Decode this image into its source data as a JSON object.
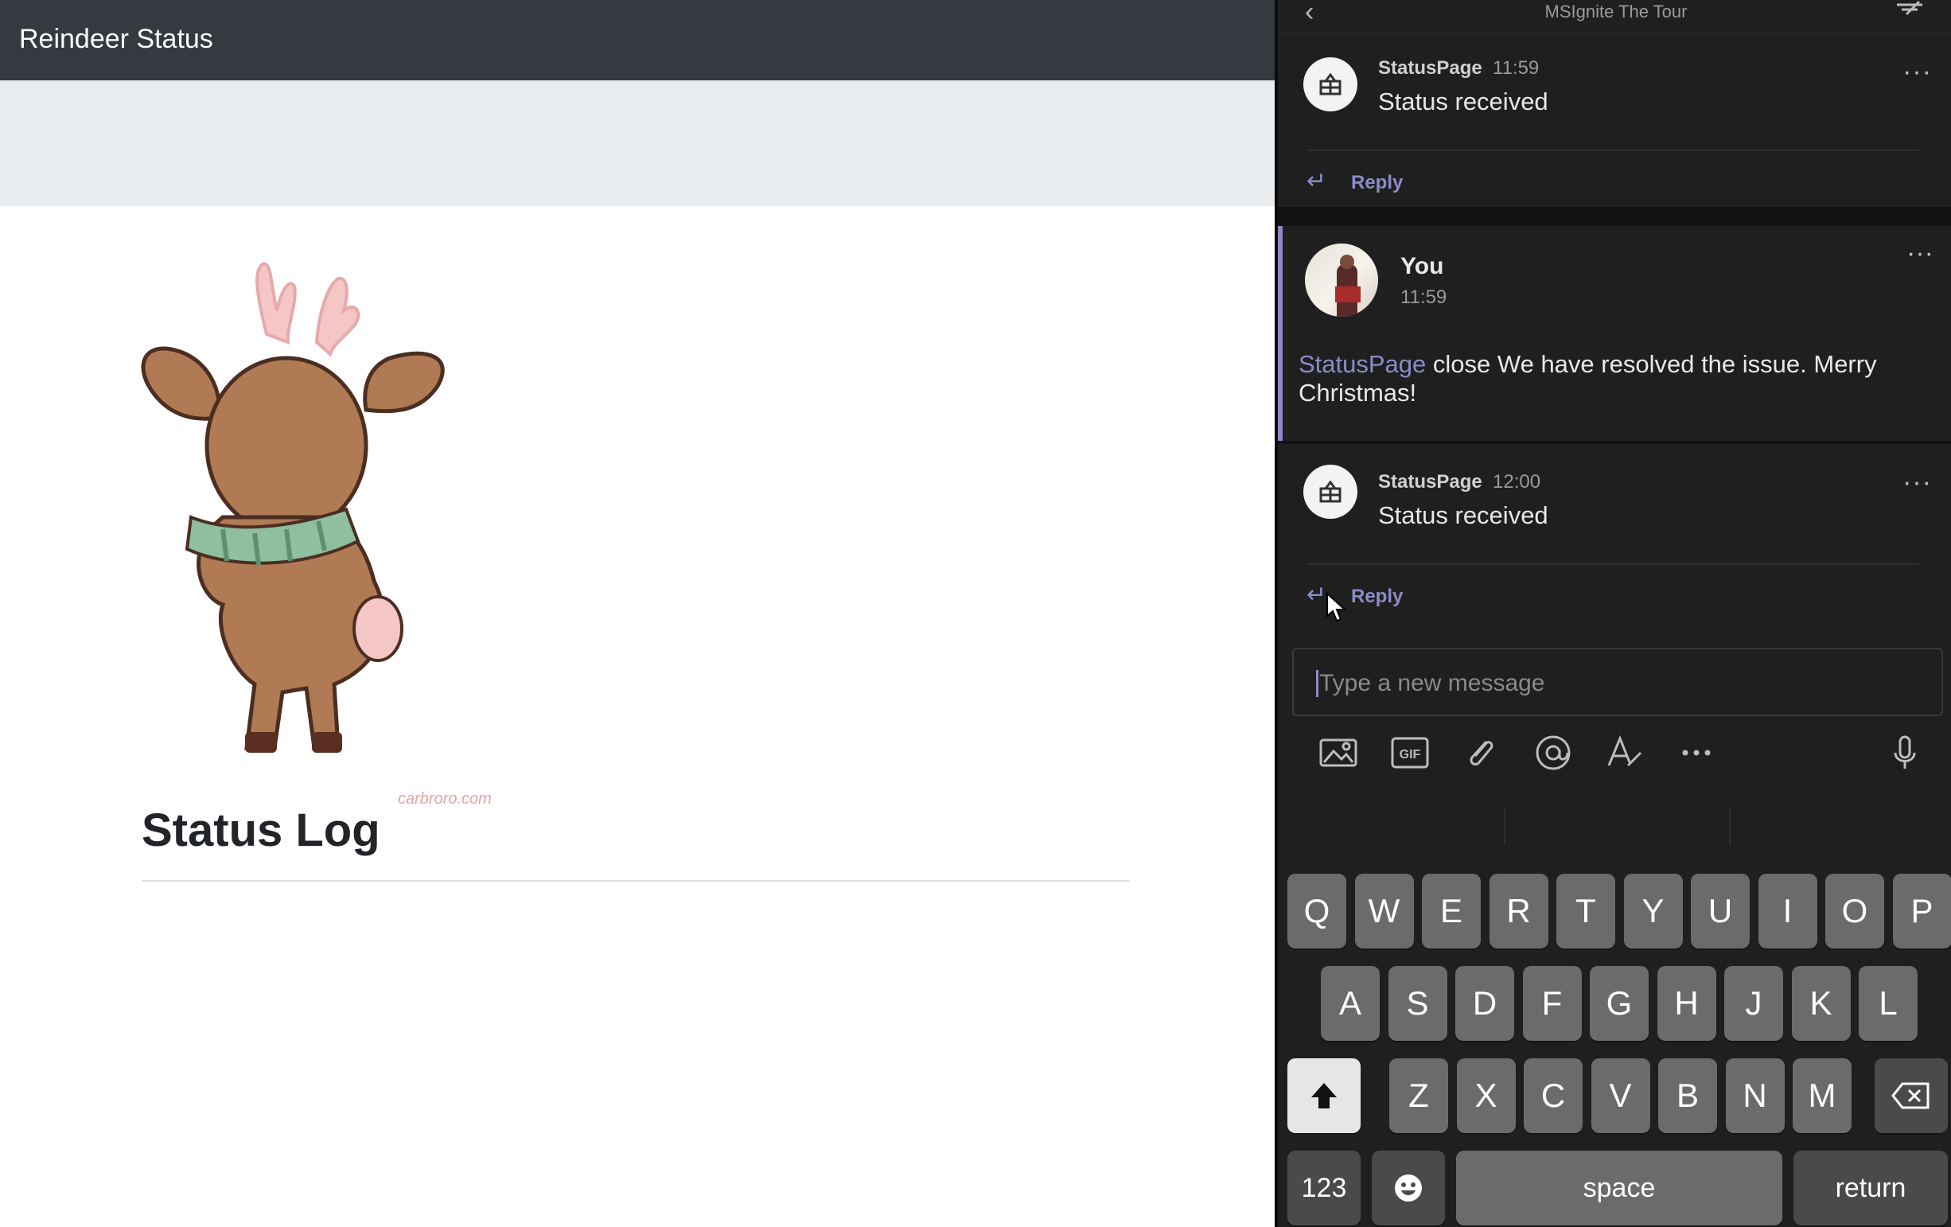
{
  "left_page": {
    "brand": "Reindeer Status",
    "watermark": "carbroro.com",
    "status_log_title": "Status Log"
  },
  "chat": {
    "title": "MSIgnite The Tour",
    "messages": [
      {
        "author": "StatusPage",
        "time": "11:59",
        "text": "Status received",
        "reply_label": "Reply"
      },
      {
        "author": "You",
        "time": "11:59",
        "mention": "StatusPage",
        "text": " close We have resolved the issue. Merry Christmas!"
      },
      {
        "author": "StatusPage",
        "time": "12:00",
        "text": "Status received",
        "reply_label": "Reply"
      }
    ],
    "compose_placeholder": "Type a new message",
    "toolbar_icons": [
      "image-icon",
      "gif-icon",
      "attach-icon",
      "mention-icon",
      "format-icon",
      "more-icon",
      "microphone-icon"
    ],
    "gif_label": "GIF"
  },
  "keyboard": {
    "row1": [
      "Q",
      "W",
      "E",
      "R",
      "T",
      "Y",
      "U",
      "I",
      "O",
      "P"
    ],
    "row2": [
      "A",
      "S",
      "D",
      "F",
      "G",
      "H",
      "J",
      "K",
      "L"
    ],
    "row3": [
      "Z",
      "X",
      "C",
      "V",
      "B",
      "N",
      "M"
    ],
    "numbers_label": "123",
    "space_label": "space",
    "return_label": "return"
  },
  "colors": {
    "navbar": "#343a40",
    "banner": "#e9ecef",
    "teams_accent": "#8b8cc7",
    "chat_bg": "#1f1f1f",
    "key_bg": "#6b6b6b"
  }
}
